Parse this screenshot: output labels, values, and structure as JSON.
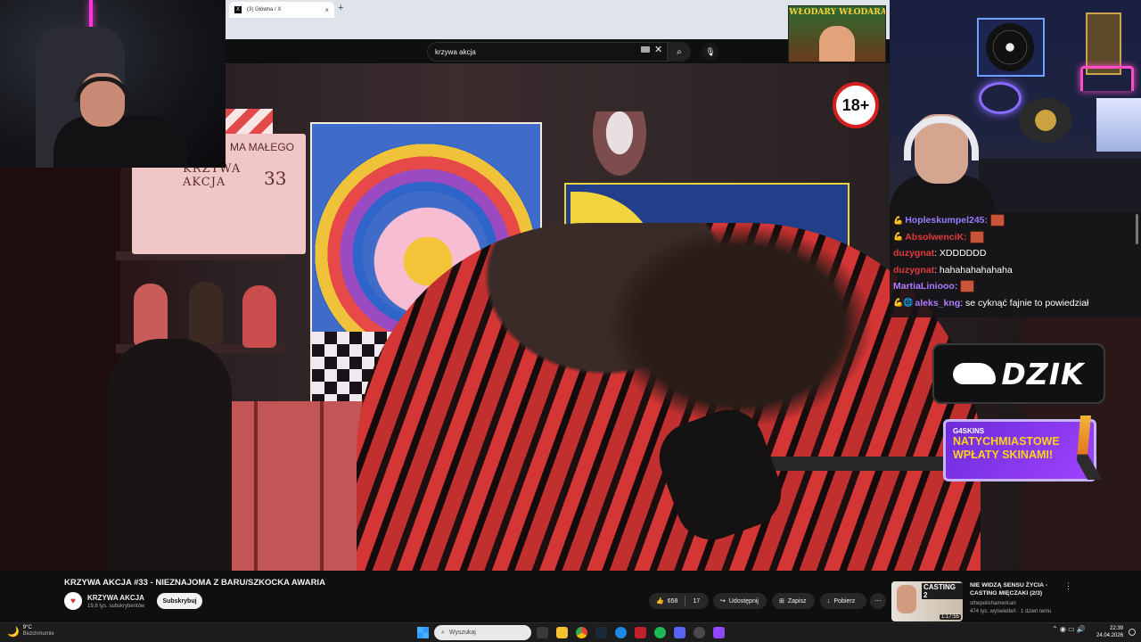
{
  "browser": {
    "tab_title": "(3) Główna / X",
    "tab_close": "×",
    "new_tab": "+"
  },
  "youtube": {
    "search_value": "krzywa akcja",
    "clear_icon": "✕",
    "search_icon": "⌕",
    "mic_icon": "🎙"
  },
  "video": {
    "title": "KRZYWA AKCJA #33 - NIEZNAJOMA Z BARU/SZKOCKA AWARIA",
    "clapper_line1": "KRZYWA AKCJA",
    "clapper_line2": "MA MAŁEGO",
    "clapper_number": "33",
    "poster_title": "WŁODARY WŁODARA",
    "age_badge": "18+"
  },
  "channel": {
    "avatar_glyph": "♥",
    "name": "KRZYWA AKCJA",
    "subscribers": "19,8 tys. subskrybentów",
    "subscribe_label": "Subskrybuj"
  },
  "actions": {
    "like_icon": "👍",
    "likes": "658",
    "dislike_count": "17",
    "share_icon": "↪",
    "share_label": "Udostępnij",
    "save_icon": "⊞",
    "save_label": "Zapisz",
    "download_icon": "↓",
    "download_label": "Pobierz",
    "more_icon": "⋯"
  },
  "recommendation": {
    "tag": "CASTING 2",
    "duration": "1:17:55",
    "title": "NIE WIDZĄ SENSU ŻYCIA - CASTING MIĘCZAKI (2/3)",
    "channel": "sthepolishamerican",
    "meta": "474 tys. wyświetleń · 1 dzień temu",
    "more_icon": "⋮"
  },
  "chat": {
    "messages": [
      {
        "badge": "💪",
        "user": "Hopleskumpel245:",
        "color": "#9b7bff",
        "text": "",
        "emote": true
      },
      {
        "badge": "💪",
        "user": "AbsolwenciK:",
        "color": "#e23b3b",
        "text": "",
        "emote": true
      },
      {
        "badge": "",
        "user": "duzygnat",
        "color": "#e23b3b",
        "text": ": XDDDDDD",
        "emote": false
      },
      {
        "badge": "",
        "user": "duzygnat",
        "color": "#e23b3b",
        "text": ": hahahahahahaha",
        "emote": false
      },
      {
        "badge": "",
        "user": "MartiaLiniooo:",
        "color": "#b07bff",
        "text": "",
        "emote": true
      },
      {
        "badge": "💪🌐",
        "user": "aleks_kng",
        "color": "#b07bff",
        "text": ": se cyknąć fajnie to powiedział",
        "emote": false
      }
    ]
  },
  "sponsors": {
    "dzik": "DZIK",
    "skins_brand": "G4SKINS",
    "skins_line1": "NATYCHMIASTOWE",
    "skins_line2": "WPŁATY SKINAMI!"
  },
  "taskbar": {
    "weather_icon": "🌙",
    "temp": "9°C",
    "weather": "Bezchmurnie",
    "search_placeholder": "Wyszukaj",
    "search_icon": "⌕",
    "tray": "⌃  ◉  ▭  🔊",
    "time": "22:39",
    "date": "24.04.2026"
  }
}
